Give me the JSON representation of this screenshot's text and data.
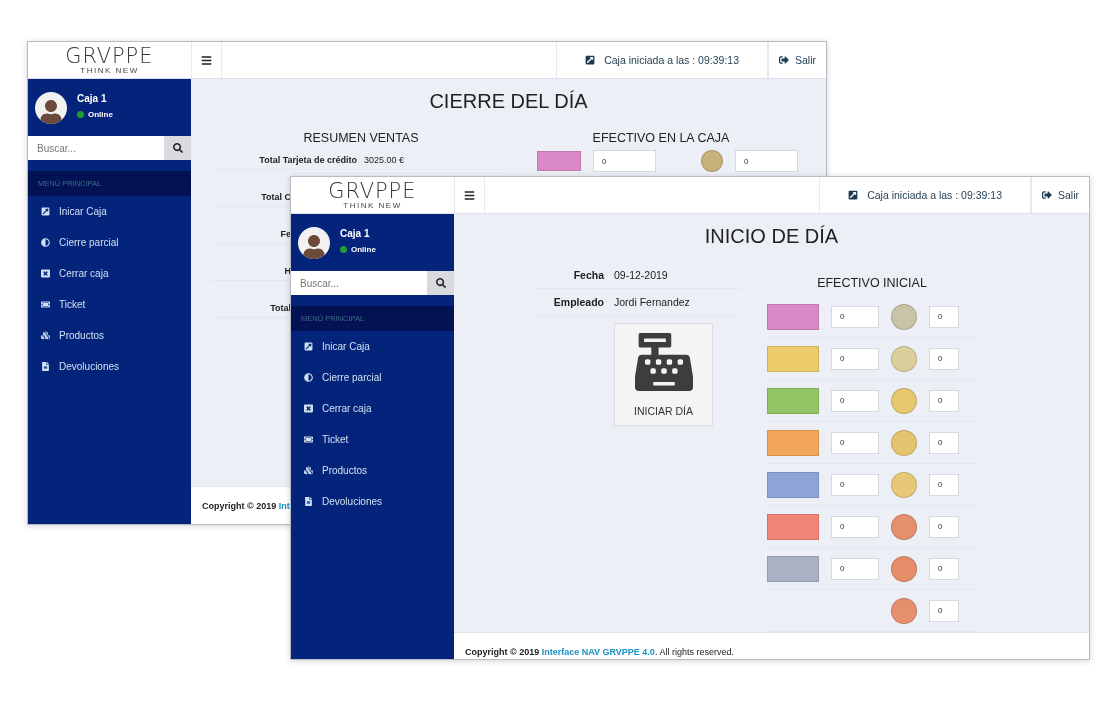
{
  "windows": [
    {
      "kind": "cierre",
      "logo": {
        "name": "GRVPPE",
        "tagline": "THINK NEW"
      },
      "header": {
        "session": "Caja iniciada a las : 09:39:13",
        "logout": "Salir"
      },
      "user": {
        "name": "Caja 1",
        "status": "Online"
      },
      "search": {
        "placeholder": "Buscar..."
      },
      "menu": {
        "title": "MENÚ PRINCIPAL",
        "items": [
          "Inicar Caja",
          "Cierre parcial",
          "Cerrar caja",
          "Ticket",
          "Productos",
          "Devoluciones"
        ]
      },
      "title": "CIERRE DEL DÍA",
      "summary": {
        "title": "RESUMEN VENTAS",
        "rows": [
          {
            "label": "Total Tarjeta de crédito",
            "value": "3025.00 €"
          },
          {
            "label": "Total C"
          },
          {
            "label": "Fe"
          },
          {
            "label": "H"
          },
          {
            "label": "Total"
          }
        ]
      },
      "cash": {
        "title": "EFECTIVO EN LA CAJA",
        "rows": [
          {
            "note": {
              "color": "#d98ac6",
              "count": "0"
            },
            "coin": {
              "color": "#c9b27a",
              "count": "0"
            }
          }
        ]
      },
      "footer": {
        "text": "Copyright © 2019 ",
        "link": "Int"
      }
    },
    {
      "kind": "inicio",
      "logo": {
        "name": "GRVPPE",
        "tagline": "THINK NEW"
      },
      "header": {
        "session": "Caja iniciada a las : 09:39:13",
        "logout": "Salir"
      },
      "user": {
        "name": "Caja 1",
        "status": "Online"
      },
      "search": {
        "placeholder": "Buscar..."
      },
      "menu": {
        "title": "MENÚ PRINCIPAL",
        "items": [
          "Inicar Caja",
          "Cierre parcial",
          "Cerrar caja",
          "Ticket",
          "Productos",
          "Devoluciones"
        ]
      },
      "title": "INICIO DE DÍA",
      "info": [
        {
          "label": "Fecha",
          "value": "09-12-2019"
        },
        {
          "label": "Empleado",
          "value": "Jordi Fernandez"
        }
      ],
      "start_button": "INICIAR DÍA",
      "cash": {
        "title": "EFECTIVO INICIAL",
        "rows": [
          {
            "note": {
              "color": "#d98ac6",
              "count": "0"
            },
            "coin": {
              "color": "#c9c3a8",
              "count": "0"
            }
          },
          {
            "note": {
              "color": "#eccb6a",
              "count": "0"
            },
            "coin": {
              "color": "#dccf9c",
              "count": "0"
            }
          },
          {
            "note": {
              "color": "#93c465",
              "count": "0"
            },
            "coin": {
              "color": "#e6c66e",
              "count": "0"
            }
          },
          {
            "note": {
              "color": "#f2a75a",
              "count": "0"
            },
            "coin": {
              "color": "#e3c46e",
              "count": "0"
            }
          },
          {
            "note": {
              "color": "#8ea4d6",
              "count": "0"
            },
            "coin": {
              "color": "#e6c877",
              "count": "0"
            }
          },
          {
            "note": {
              "color": "#ef8574",
              "count": "0"
            },
            "coin": {
              "color": "#e4906c",
              "count": "0"
            }
          },
          {
            "note": {
              "color": "#aab1c4",
              "count": "0"
            },
            "coin": {
              "color": "#e58d68",
              "count": "0"
            }
          },
          {
            "coin": {
              "color": "#e58f6c",
              "count": "0"
            }
          }
        ]
      },
      "footer": {
        "text": "Copyright © 2019 ",
        "link": "Interface NAV GRVPPE 4.0",
        "suffix": ". All rights reserved."
      }
    }
  ]
}
